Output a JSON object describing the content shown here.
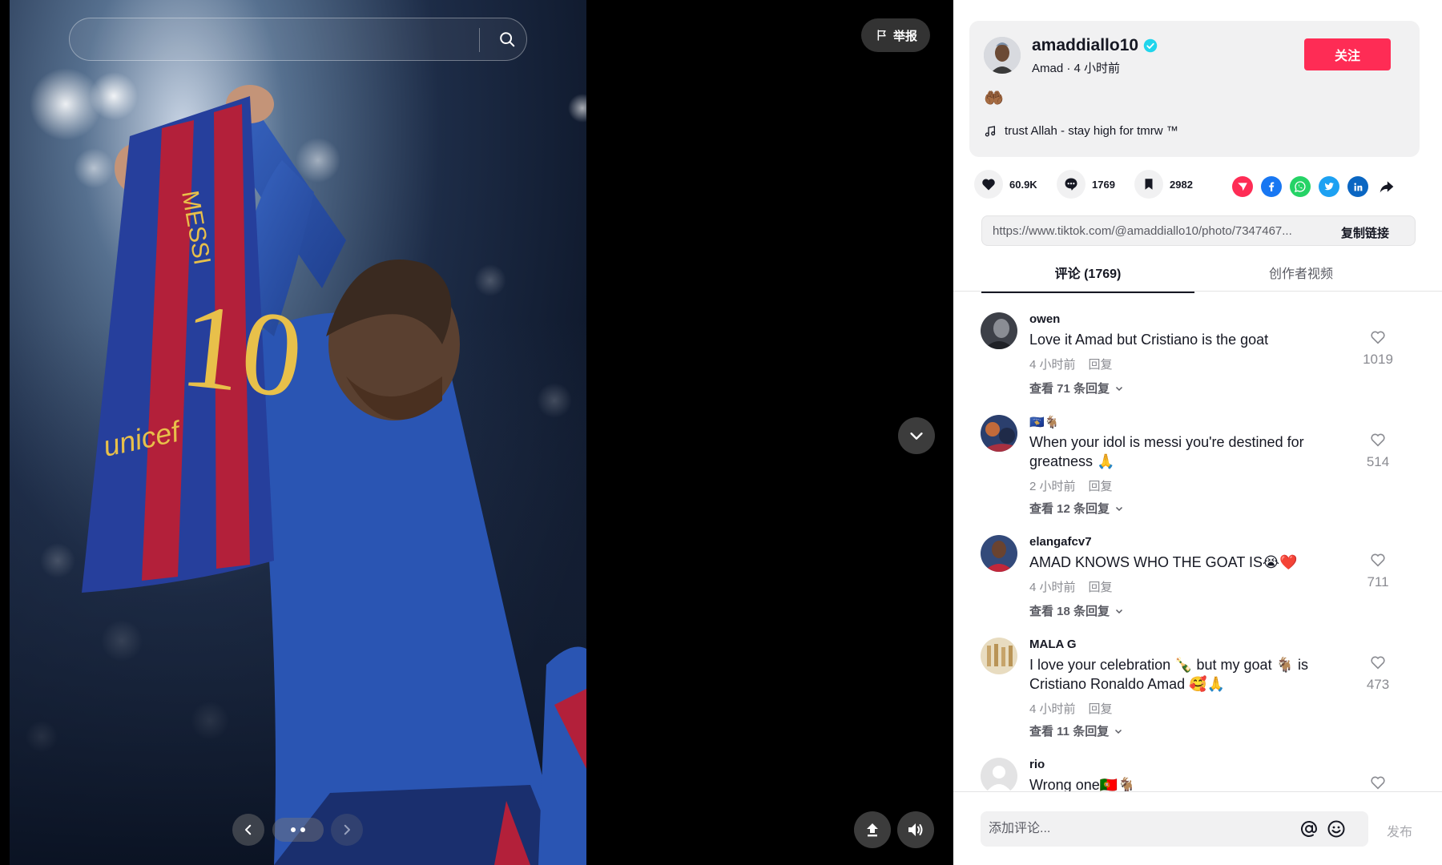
{
  "search": {
    "placeholder": ""
  },
  "viewer": {
    "report_label": "举报",
    "carousel": {
      "current": 1,
      "total": 2
    }
  },
  "post": {
    "username": "amaddiallo10",
    "display_name": "Amad",
    "time_ago": "4 小时前",
    "follow_label": "关注",
    "caption": "🤲🏾",
    "music": "trust Allah - stay high for tmrw ™",
    "verified": true
  },
  "stats": {
    "likes": "60.9K",
    "comments": "1769",
    "saves": "2982"
  },
  "share_icons": [
    "send-to-friends-icon",
    "facebook-icon",
    "whatsapp-icon",
    "twitter-icon",
    "linkedin-icon",
    "share-more-icon"
  ],
  "colors": {
    "accent": "#fe2c55",
    "verified": "#20d5ec",
    "facebook": "#1877f2",
    "whatsapp": "#25d366",
    "twitter": "#1da1f2",
    "linkedin": "#0a66c2"
  },
  "link": {
    "url": "https://www.tiktok.com/@amaddiallo10/photo/7347467...",
    "copy_label": "复制链接"
  },
  "tabs": [
    {
      "label": "评论 (1769)",
      "active": true
    },
    {
      "label": "创作者视频",
      "active": false
    }
  ],
  "comments": [
    {
      "name": "owen",
      "text": "Love it Amad but Cristiano is the goat",
      "time": "4 小时前",
      "reply": "回复",
      "more": "查看 71 条回复",
      "likes": "1019"
    },
    {
      "name": "🇽🇰🐐",
      "text": "When your idol is messi you're destined for greatness 🙏",
      "time": "2 小时前",
      "reply": "回复",
      "more": "查看 12 条回复",
      "likes": "514"
    },
    {
      "name": "elangafcv7",
      "text": "AMAD KNOWS WHO THE GOAT IS😭❤️",
      "time": "4 小时前",
      "reply": "回复",
      "more": "查看 18 条回复",
      "likes": "711"
    },
    {
      "name": "MALA G",
      "text": "I love your celebration 🍾 but my goat 🐐 is Cristiano Ronaldo Amad 🥰🙏",
      "time": "4 小时前",
      "reply": "回复",
      "more": "查看 11 条回复",
      "likes": "473"
    },
    {
      "name": "rio",
      "text": "Wrong one🇵🇹🐐",
      "time": "",
      "reply": "",
      "more": "",
      "likes": ""
    }
  ],
  "comment_input": {
    "placeholder": "添加评论...",
    "post_label": "发布"
  }
}
